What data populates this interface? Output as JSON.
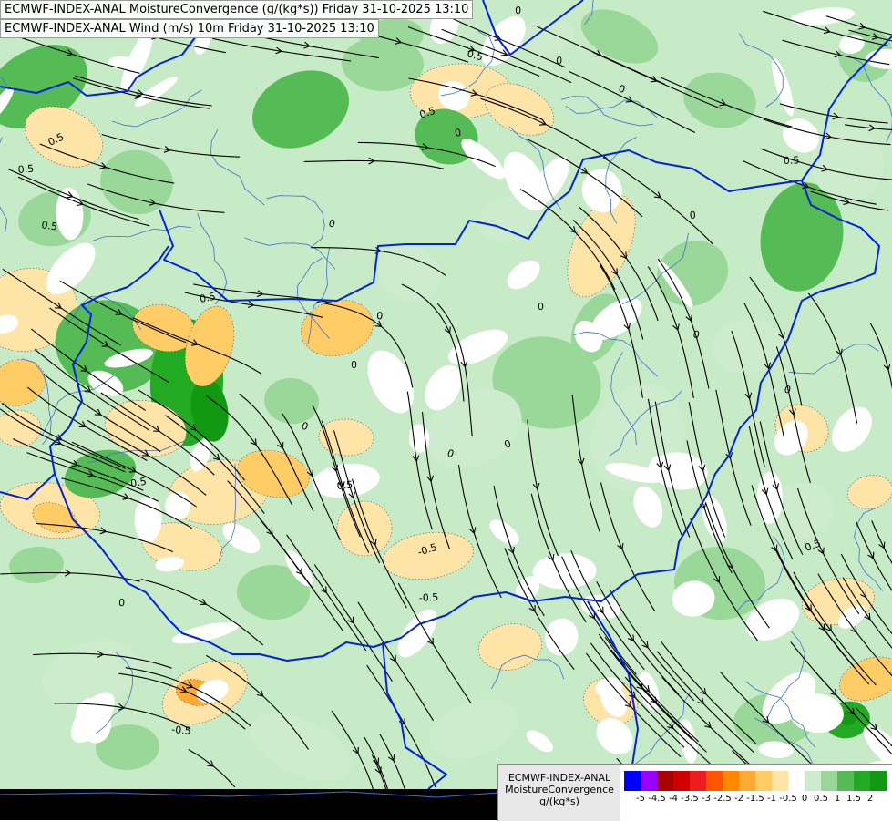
{
  "titles": {
    "line1": "ECMWF-INDEX-ANAL MoistureConvergence (g/(kg*s)) Friday 31-10-2025 13:10",
    "line2": "ECMWF-INDEX-ANAL Wind (m/s) 10m Friday 31-10-2025 13:10"
  },
  "legend": {
    "model": "ECMWF-INDEX-ANAL",
    "parameter": "MoistureConvergence",
    "unit": "g/(kg*s)",
    "tick_labels": [
      "-5",
      "-4.5",
      "-4",
      "-3.5",
      "-3",
      "-2.5",
      "-2",
      "-1.5",
      "-1",
      "-0.5",
      "0",
      "0.5",
      "1",
      "1.5",
      "2"
    ],
    "colors": [
      "#0000ff",
      "#9900ff",
      "#aa0000",
      "#d00000",
      "#ee1c1c",
      "#ff5500",
      "#ff8800",
      "#ffaa33",
      "#ffcc66",
      "#ffe4a8",
      "#ffffff",
      "#cdeccd",
      "#99d899",
      "#55bb55",
      "#22aa22",
      "#119911"
    ]
  },
  "map_features": {
    "border_color": "#0022dd",
    "river_color": "#3f6fd0",
    "streamline_color": "#000000",
    "contour_labels": [
      "0.5",
      "0",
      "0",
      "0.5",
      "0",
      "0",
      "0.5",
      "0",
      "0",
      "0.5",
      "0",
      "-0.5",
      "0",
      "0.5",
      "0",
      "0",
      "0.5",
      "0",
      "-0.5",
      "0",
      "0.5",
      "-0.5",
      "0",
      "0.5",
      "0",
      "0.5",
      "-0.5",
      "0"
    ]
  }
}
